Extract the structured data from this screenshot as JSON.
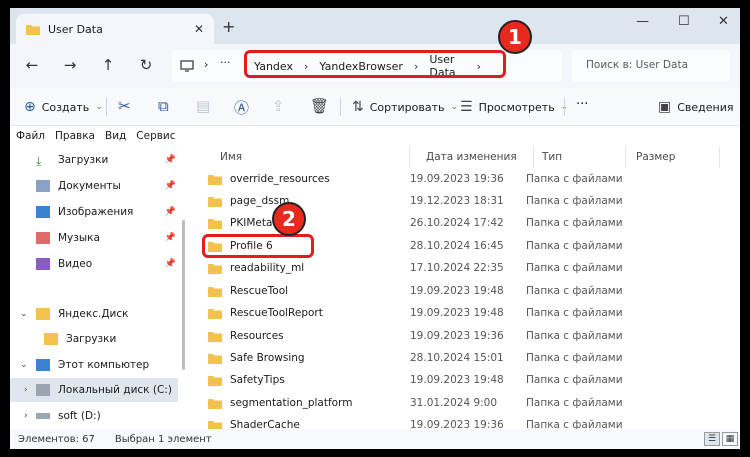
{
  "tab": {
    "title": "User Data",
    "close": "✕",
    "add": "+"
  },
  "window_controls": {
    "minimize": "—",
    "maximize": "☐",
    "close": "✕"
  },
  "nav": {
    "back": "←",
    "forward": "→",
    "up": "↑",
    "refresh": "↻",
    "more": "···",
    "breadcrumbs": [
      "Yandex",
      "YandexBrowser",
      "User Data"
    ],
    "search_placeholder": "Поиск в: User Data"
  },
  "toolbar": {
    "create_label": "Создать",
    "sort_label": "Сортировать",
    "view_label": "Просмотреть",
    "more": "···",
    "details_label": "Сведения"
  },
  "menu": [
    "Файл",
    "Правка",
    "Вид",
    "Сервис"
  ],
  "sidebar": {
    "items": [
      {
        "label": "Загрузки",
        "icon": "download-icon",
        "pinned": true
      },
      {
        "label": "Документы",
        "icon": "document-icon",
        "pinned": true
      },
      {
        "label": "Изображения",
        "icon": "image-icon",
        "pinned": true
      },
      {
        "label": "Музыка",
        "icon": "music-icon",
        "pinned": true
      },
      {
        "label": "Видео",
        "icon": "video-icon",
        "pinned": true
      },
      {
        "label": "Яндекс.Диск",
        "icon": "cloud-folder-icon"
      },
      {
        "label": "Загрузки",
        "icon": "folder-icon"
      },
      {
        "label": "Этот компьютер",
        "icon": "computer-icon"
      },
      {
        "label": "Локальный диск (C:)",
        "icon": "drive-icon"
      },
      {
        "label": "soft (D:)",
        "icon": "drive-icon"
      }
    ]
  },
  "columns": {
    "name": "Имя",
    "date": "Дата изменения",
    "type": "Тип",
    "size": "Размер"
  },
  "files": [
    {
      "name": "override_resources",
      "date": "19.09.2023 19:36",
      "type": "Папка с файлами"
    },
    {
      "name": "page_dssm",
      "date": "19.12.2023 18:31",
      "type": "Папка с файлами"
    },
    {
      "name": "PKIMetada",
      "date": "26.10.2024 17:42",
      "type": "Папка с файлами"
    },
    {
      "name": "Profile 6",
      "date": "28.10.2024 16:45",
      "type": "Папка с файлами"
    },
    {
      "name": "readability_ml",
      "date": "17.10.2024 22:35",
      "type": "Папка с файлами"
    },
    {
      "name": "RescueTool",
      "date": "19.09.2023 19:48",
      "type": "Папка с файлами"
    },
    {
      "name": "RescueToolReport",
      "date": "19.09.2023 19:48",
      "type": "Папка с файлами"
    },
    {
      "name": "Resources",
      "date": "19.09.2023 19:36",
      "type": "Папка с файлами"
    },
    {
      "name": "Safe Browsing",
      "date": "28.10.2024 15:01",
      "type": "Папка с файлами"
    },
    {
      "name": "SafetyTips",
      "date": "19.09.2023 19:48",
      "type": "Папка с файлами"
    },
    {
      "name": "segmentation_platform",
      "date": "31.01.2024 9:00",
      "type": "Папка с файлами"
    },
    {
      "name": "ShaderCache",
      "date": "19.09.2023 19:36",
      "type": "Папка с файлами"
    }
  ],
  "badges": [
    "1",
    "2"
  ],
  "status": {
    "count": "Элементов: 67",
    "selected": "Выбран 1 элемент"
  },
  "colors": {
    "accent_red": "#e11d22",
    "folder_yellow": "#f2c14e"
  }
}
